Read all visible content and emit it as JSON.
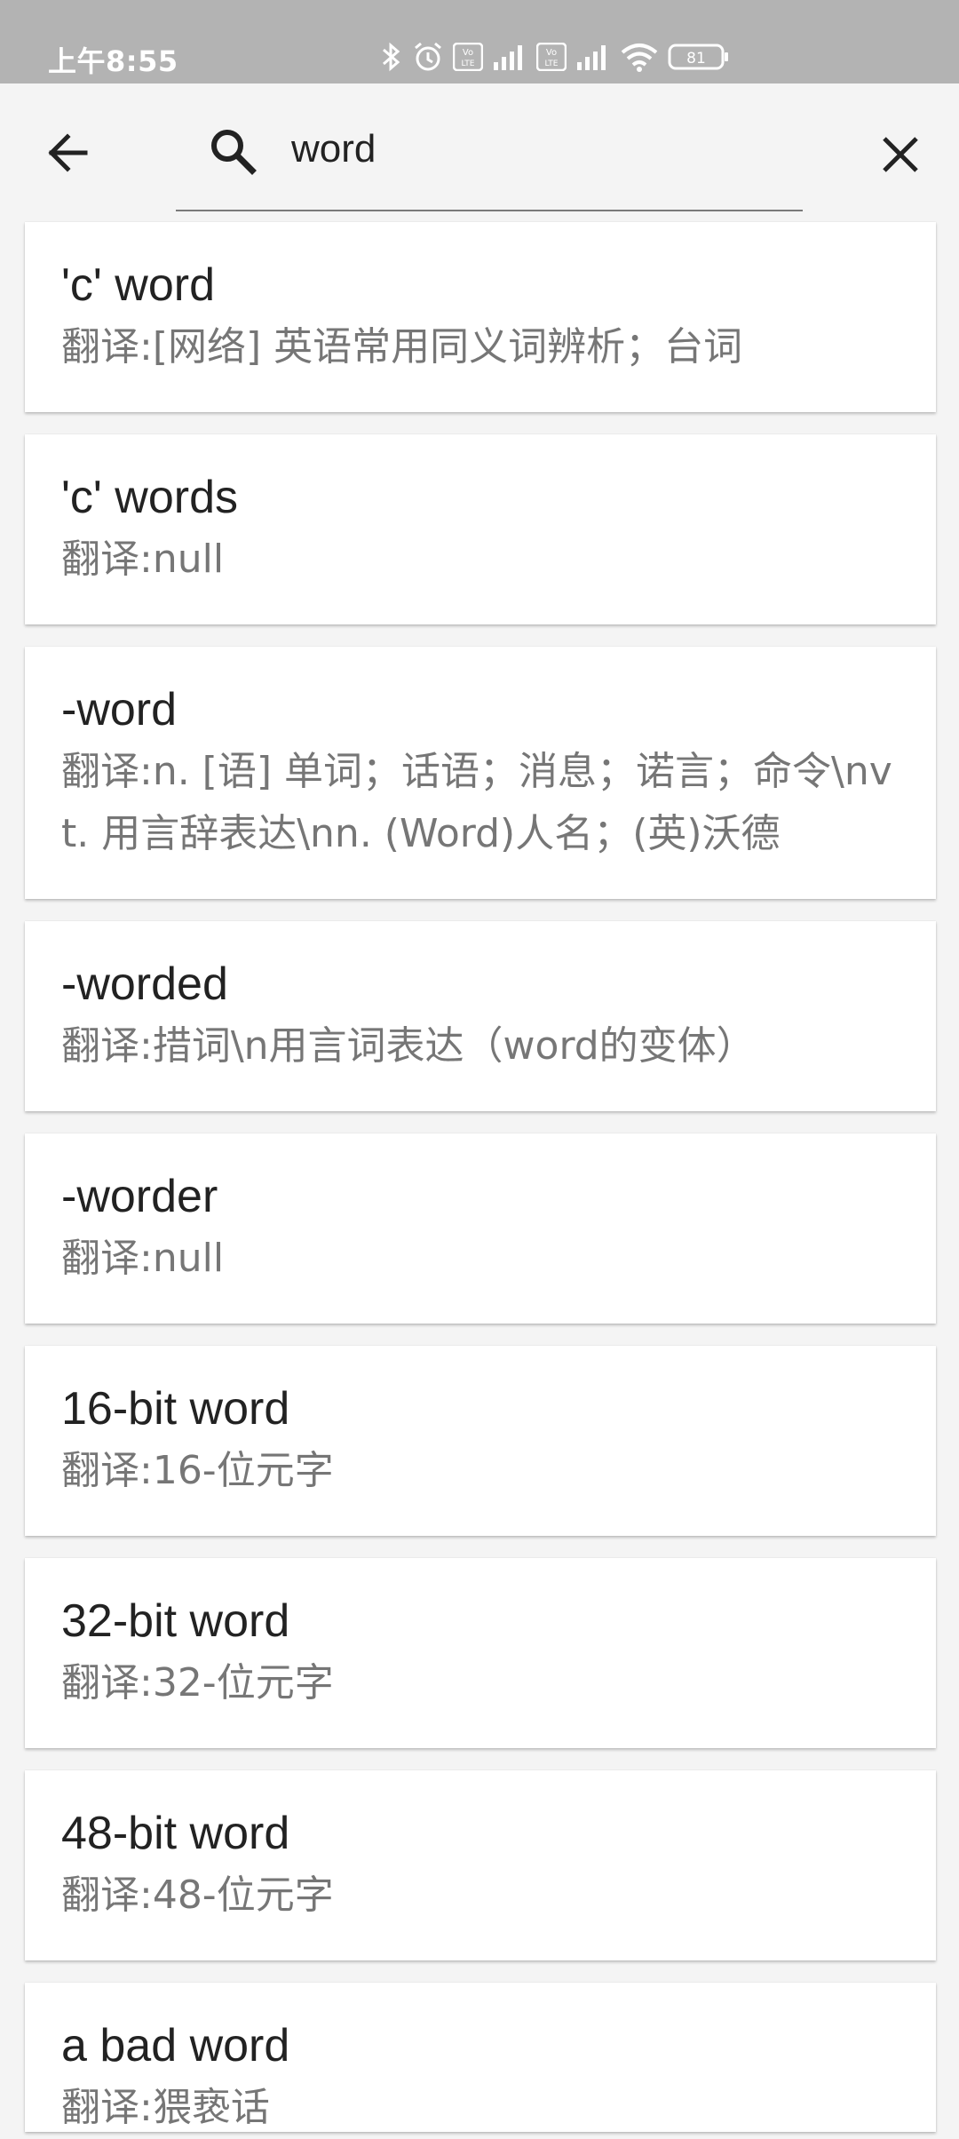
{
  "status_bar": {
    "time": "上午8:55",
    "battery": "81",
    "icons": [
      "bluetooth-icon",
      "alarm-icon",
      "volte-icon",
      "signal-icon",
      "volte-icon",
      "signal-icon",
      "wifi-icon",
      "battery-icon"
    ]
  },
  "app_bar": {
    "back_icon": "arrow-left-icon",
    "search_icon": "search-icon",
    "clear_icon": "close-icon",
    "query": "word"
  },
  "results": [
    {
      "word": "'c' word",
      "translation": "翻译:[网络] 英语常用同义词辨析；台词"
    },
    {
      "word": "'c' words",
      "translation": "翻译:null"
    },
    {
      "word": "-word",
      "translation": "翻译:n. [语] 单词；话语；消息；诺言；命令\\nvt. 用言辞表达\\nn. (Word)人名；(英)沃德"
    },
    {
      "word": "-worded",
      "translation": "翻译:措词\\n用言词表达（word的变体）"
    },
    {
      "word": "-worder",
      "translation": "翻译:null"
    },
    {
      "word": "16-bit word",
      "translation": "翻译:16-位元字"
    },
    {
      "word": "32-bit word",
      "translation": "翻译:32-位元字"
    },
    {
      "word": "48-bit word",
      "translation": "翻译:48-位元字"
    },
    {
      "word": "a bad word",
      "translation": "翻译:猥亵话"
    }
  ],
  "colors": {
    "status_bar": "#b3b3b3",
    "background": "#f4f4f4",
    "card": "#ffffff",
    "word_text": "#222222",
    "translation_text": "#767676"
  }
}
